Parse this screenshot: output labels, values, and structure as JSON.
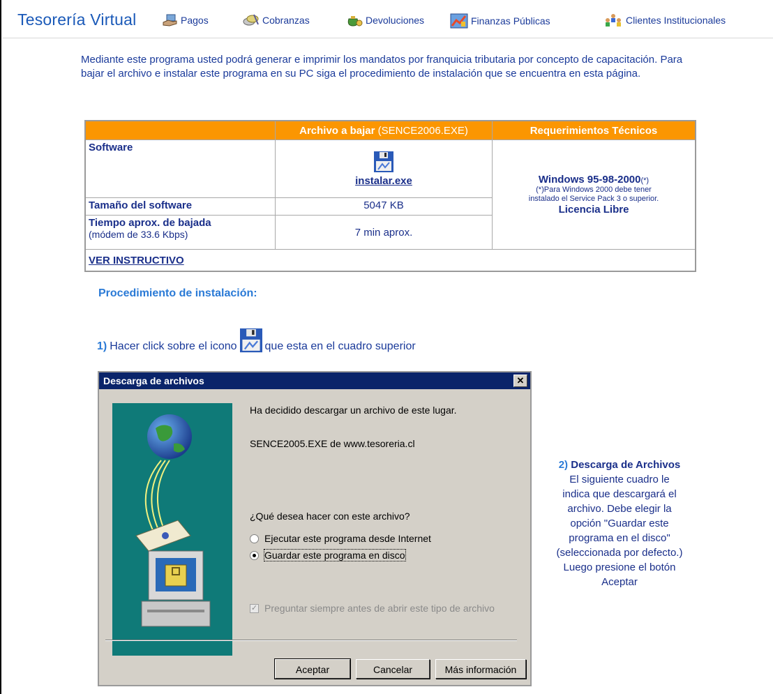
{
  "header": {
    "brand": "Tesorería Virtual",
    "nav": [
      {
        "label": "Pagos",
        "icon": "hand-payment-icon"
      },
      {
        "label": "Cobranzas",
        "icon": "coins-icon"
      },
      {
        "label": "Devoluciones",
        "icon": "money-bag-icon"
      },
      {
        "label": "Finanzas Públicas",
        "icon": "chart-icon"
      },
      {
        "label": "Clientes Institucionales",
        "icon": "people-icon"
      }
    ]
  },
  "intro": "Mediante este programa usted podrá generar e imprimir los mandatos por franquicia tributaria por concepto de capacitación. Para bajar el archivo e instalar este programa en su PC siga el procedimiento de instalación que se encuentra en esta página.",
  "download_table": {
    "col2_header_bold": "Archivo a bajar",
    "col2_header_light": " (SENCE2006.EXE)",
    "col3_header": "Requerimientos Técnicos",
    "row_software": "Software",
    "file_link": "instalar.exe",
    "row_size": "Tamaño del software",
    "size_value": "5047 KB",
    "row_time": "Tiempo aprox. de bajada",
    "row_time_sub": "(módem de 33.6 Kbps)",
    "time_value": "7 min aprox.",
    "req_os": "Windows 95-98-2000",
    "req_os_mark": "(*)",
    "req_note_1": "(*)Para Windows 2000 debe tener",
    "req_note_2": "instalado el Service Pack 3 o superior.",
    "req_license": "Licencia Libre",
    "instructivo_link": "VER INSTRUCTIVO"
  },
  "procedure": {
    "title": "Procedimiento de instalación:",
    "step1_num": "1)",
    "step1_pre": "Hacer click sobre el icono",
    "step1_post": "que esta en el cuadro superior"
  },
  "dialog": {
    "title": "Descarga de archivos",
    "close_glyph": "✕",
    "line1": "Ha decidido descargar un archivo de este lugar.",
    "line2": "SENCE2005.EXE  de  www.tesoreria.cl",
    "question": "¿Qué desea hacer con este archivo?",
    "option_run": "Ejecutar este programa desde Internet",
    "option_save": "Guardar este programa en disco",
    "selected_option": "save",
    "always_ask": "Preguntar siempre antes de abrir este tipo de archivo",
    "btn_ok": "Aceptar",
    "btn_cancel": "Cancelar",
    "btn_more": "Más información"
  },
  "step2": {
    "num": "2)",
    "title": "Descarga de Archivos",
    "lines": [
      "El siguiente cuadro le",
      "indica que descargará el",
      "archivo. Debe elegir la",
      "opción \"Guardar este",
      "programa en el disco\"",
      "(seleccionada por defecto.)",
      "Luego presione el botón",
      "Aceptar"
    ]
  },
  "colors": {
    "brand_blue": "#1a59b8",
    "table_header_orange": "#fb9601",
    "text_navy": "#1a2f8a",
    "dialog_title_bar": "#0a246a",
    "dialog_art_teal": "#0f7a78"
  }
}
